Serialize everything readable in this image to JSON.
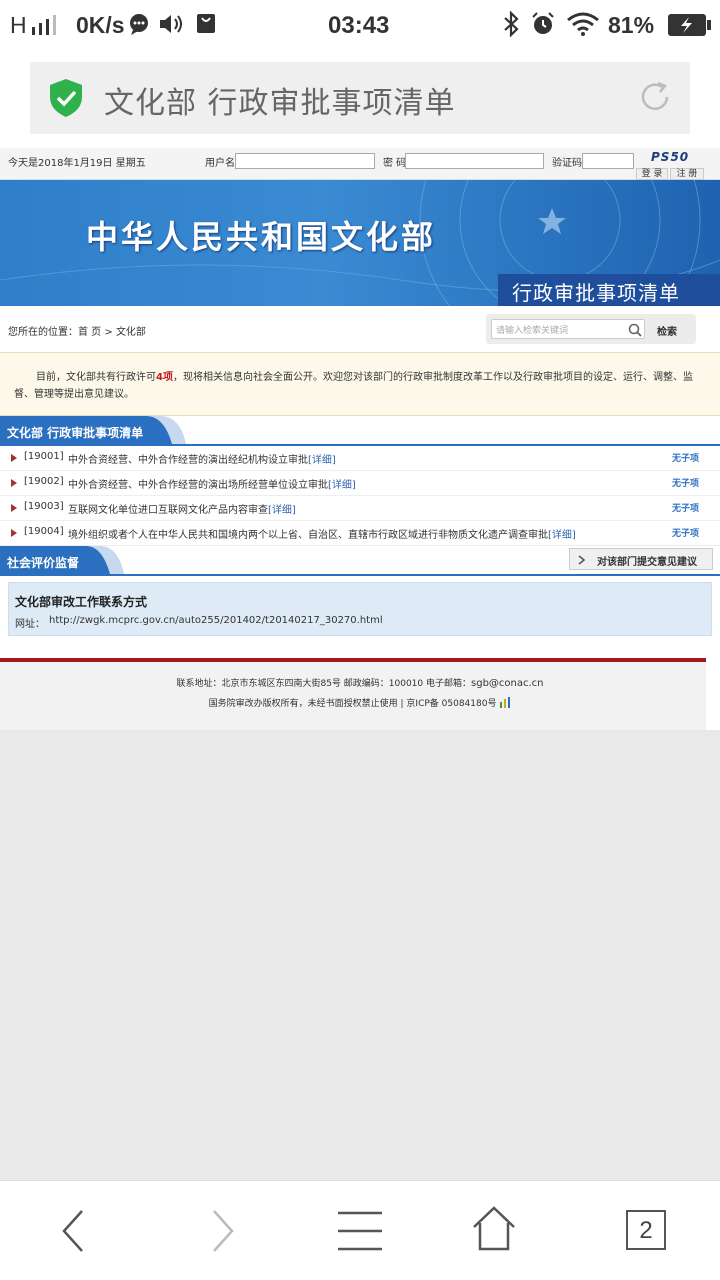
{
  "status_bar": {
    "signal": "H",
    "speed": "0K/s",
    "time": "03:43",
    "battery": "81%"
  },
  "address_bar": {
    "title": "文化部 行政审批事项清单"
  },
  "login_bar": {
    "date": "今天是2018年1月19日 星期五",
    "username_label": "用户名",
    "password_label": "密 码",
    "captcha_label": "验证码",
    "captcha_value": "PS50",
    "login_label": "登 录",
    "register_label": "注 册"
  },
  "banner": {
    "title": "中华人民共和国文化部",
    "subtitle": "行政审批事项清单"
  },
  "breadcrumb": {
    "prefix": "您所在的位置：",
    "home": "首 页",
    "sep": " > ",
    "current": "文化部"
  },
  "search": {
    "placeholder": "请输入检索关键词",
    "button": "检索"
  },
  "notice": {
    "line1_before": "目前，文化部共有行政许可",
    "count": "4项",
    "line1_after": "，现将相关信息向社会全面公开。欢迎您对该部门的行政审批制度改革工作以及行政审批项目的设定、运行、调整、监",
    "line2": "督、管理等提出意见建议。"
  },
  "section_list": {
    "title": "文化部 行政审批事项清单"
  },
  "items": [
    {
      "code": "[19001]",
      "name": "中外合资经营、中外合作经营的演出经纪机构设立审批",
      "detail": "[详细]",
      "sub": "无子项"
    },
    {
      "code": "[19002]",
      "name": "中外合资经营、中外合作经营的演出场所经营单位设立审批",
      "detail": "[详细]",
      "sub": "无子项"
    },
    {
      "code": "[19003]",
      "name": "互联网文化单位进口互联网文化产品内容审查",
      "detail": "[详细]",
      "sub": "无子项"
    },
    {
      "code": "[19004]",
      "name": "境外组织或者个人在中华人民共和国境内两个以上省、自治区、直辖市行政区域进行非物质文化遗产调查审批",
      "detail": "[详细]",
      "sub": "无子项"
    }
  ],
  "section_eval": {
    "title": "社会评价监督",
    "button": "对该部门提交意见建议"
  },
  "contact": {
    "title": "文化部审改工作联系方式",
    "url_label": "网址：",
    "url": "http://zwgk.mcprc.gov.cn/auto255/201402/t20140217_30270.html"
  },
  "footer": {
    "line1_before": "联系地址：北京市东城区东四南大街85号  邮政编码：100010  电子邮箱：",
    "email": "sgb@conac.cn",
    "line2": "国务院审改办版权所有，未经书面授权禁止使用 | 京ICP备 05084180号"
  },
  "nav": {
    "tabs_count": "2"
  }
}
